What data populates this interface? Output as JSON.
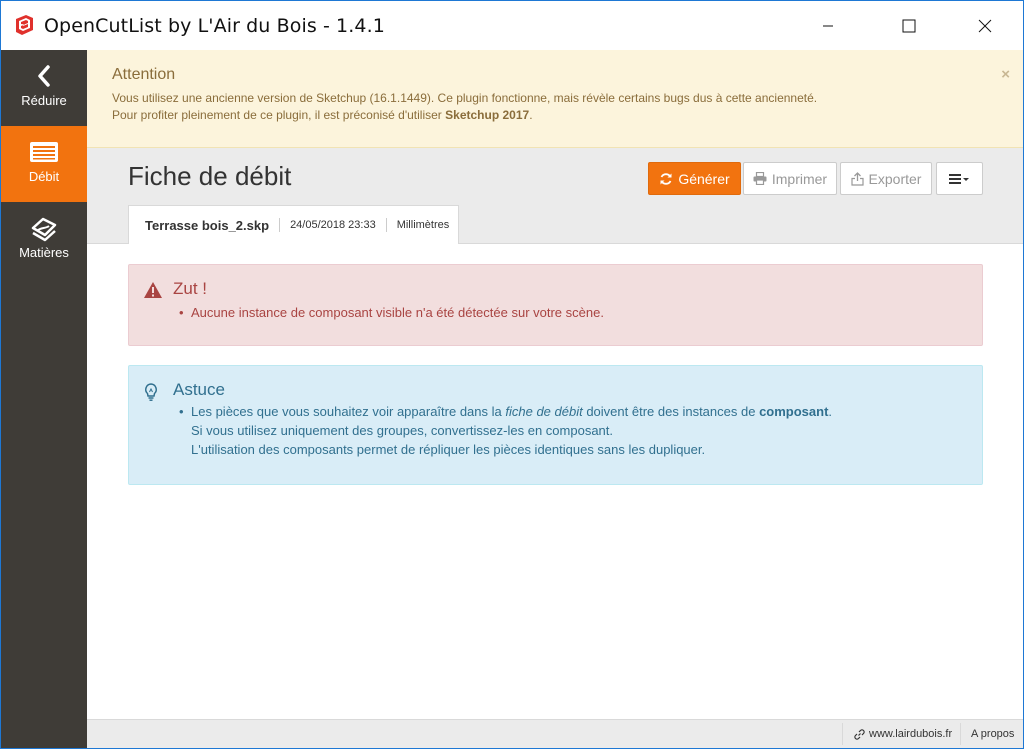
{
  "window": {
    "title": "OpenCutList by L'Air du Bois - 1.4.1",
    "accent": "#1e78d4"
  },
  "sidebar": {
    "items": [
      {
        "label": "Réduire",
        "icon": "chevron-left-icon",
        "active": false
      },
      {
        "label": "Débit",
        "icon": "list-icon",
        "active": true
      },
      {
        "label": "Matières",
        "icon": "material-icon",
        "active": false
      }
    ],
    "active_color": "#f2730f",
    "background": "#3f3c37"
  },
  "attention": {
    "title": "Attention",
    "line1": "Vous utilisez une ancienne version de Sketchup (16.1.1449). Ce plugin fonctionne, mais révèle certains bugs dus à cette ancienneté.",
    "line2_prefix": "Pour profiter pleinement de ce plugin, il est préconisé d'utiliser ",
    "line2_strong": "Sketchup 2017",
    "line2_suffix": ".",
    "close": "×"
  },
  "header": {
    "page_title": "Fiche de débit",
    "buttons": {
      "generate": "Générer",
      "print": "Imprimer",
      "export": "Exporter"
    },
    "file_tab": {
      "filename": "Terrasse bois_2.skp",
      "datetime": "24/05/2018 23:33",
      "units": "Millimètres"
    }
  },
  "alerts": {
    "danger": {
      "title": "Zut !",
      "items": [
        "Aucune instance de composant visible n'a été détectée sur votre scène."
      ]
    },
    "info": {
      "title": "Astuce",
      "line1_a": "Les pièces que vous souhaitez voir apparaître dans la ",
      "line1_em": "fiche de débit",
      "line1_b": " doivent être des instances de ",
      "line1_strong": "composant",
      "line1_c": ".",
      "line2": "Si vous utilisez uniquement des groupes, convertissez-les en composant.",
      "line3": "L'utilisation des composants permet de répliquer les pièces identiques sans les dupliquer."
    }
  },
  "statusbar": {
    "website": "www.lairdubois.fr",
    "about": "A propos"
  }
}
